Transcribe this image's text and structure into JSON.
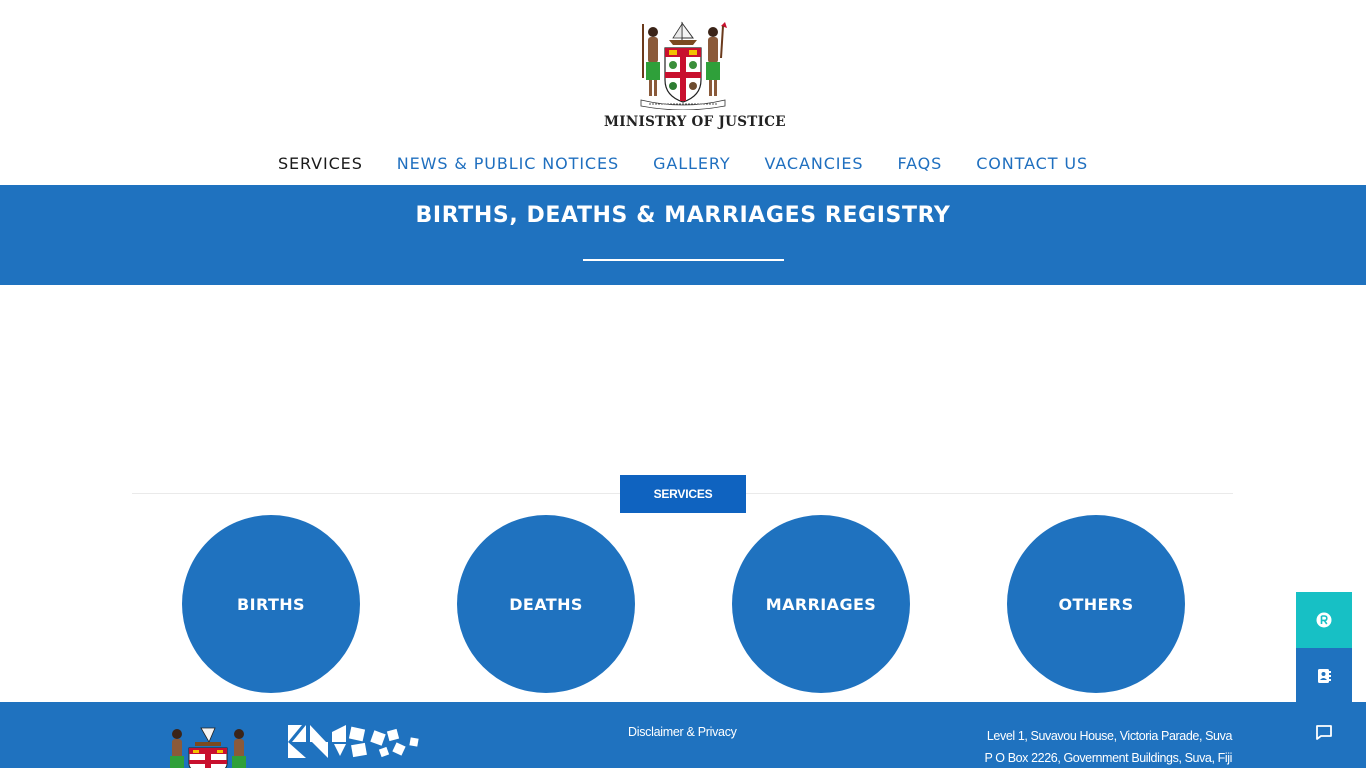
{
  "header": {
    "logo_text": "MINISTRY OF JUSTICE",
    "nav": [
      {
        "label": "SERVICES",
        "active": true
      },
      {
        "label": "NEWS & PUBLIC NOTICES",
        "active": false
      },
      {
        "label": "GALLERY",
        "active": false
      },
      {
        "label": "VACANCIES",
        "active": false
      },
      {
        "label": "FAQS",
        "active": false
      },
      {
        "label": "CONTACT US",
        "active": false
      }
    ]
  },
  "banner": {
    "title": "BIRTHS, DEATHS & MARRIAGES REGISTRY"
  },
  "services": {
    "button_label": "SERVICES",
    "items": [
      "BIRTHS",
      "DEATHS",
      "MARRIAGES",
      "OTHERS"
    ]
  },
  "footer": {
    "disclaimer_link": "Disclaimer & Privacy",
    "address_line1": "Level 1, Suvavou House, Victoria Parade, Suva",
    "address_line2": "P O Box 2226, Government Buildings, Suva, Fiji"
  },
  "side_buttons": [
    {
      "icon": "registered-icon"
    },
    {
      "icon": "contact-card-icon"
    },
    {
      "icon": "chat-icon"
    }
  ],
  "colors": {
    "brand_blue": "#1f72bf",
    "button_blue": "#0f63c0",
    "teal": "#17c0c5",
    "nav_blue": "#1f6fbf"
  }
}
